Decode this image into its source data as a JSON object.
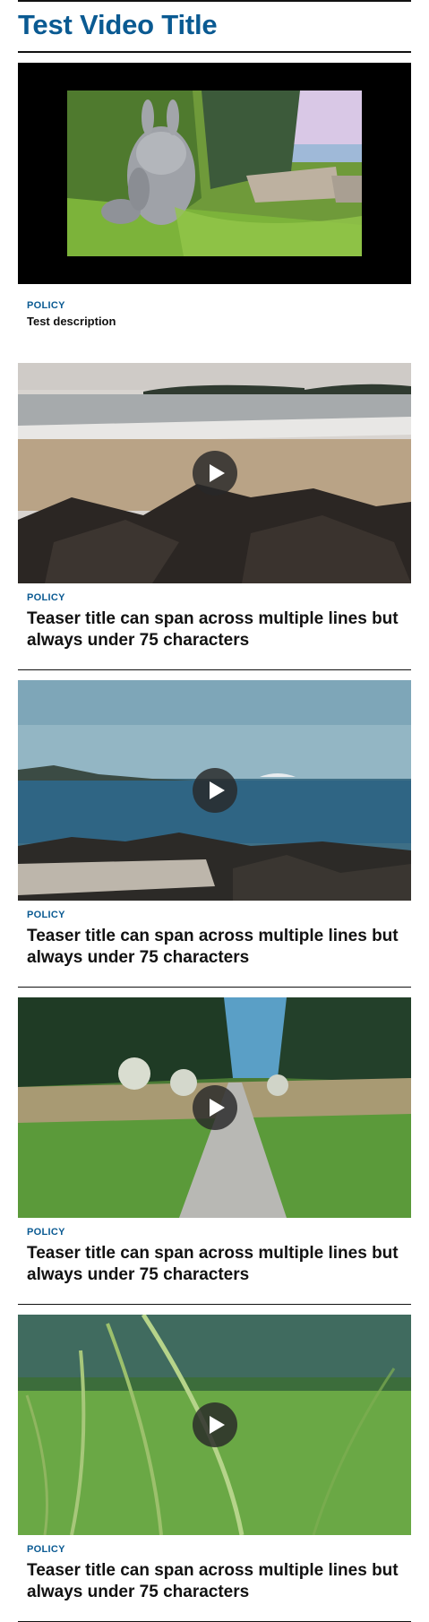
{
  "page": {
    "title": "Test Video Title"
  },
  "video": {
    "category": "POLICY",
    "description": "Test description"
  },
  "teasers": [
    {
      "category": "POLICY",
      "title": "Teaser title can span across multiple lines but always under 75 characters"
    },
    {
      "category": "POLICY",
      "title": "Teaser title can span across multiple lines but always under 75 characters"
    },
    {
      "category": "POLICY",
      "title": "Teaser title can span across multiple lines but always under 75 characters"
    },
    {
      "category": "POLICY",
      "title": "Teaser title can span across multiple lines but always under 75 characters"
    }
  ],
  "colors": {
    "accent": "#0a5a92",
    "text": "#111111",
    "player_bg": "#000000"
  }
}
